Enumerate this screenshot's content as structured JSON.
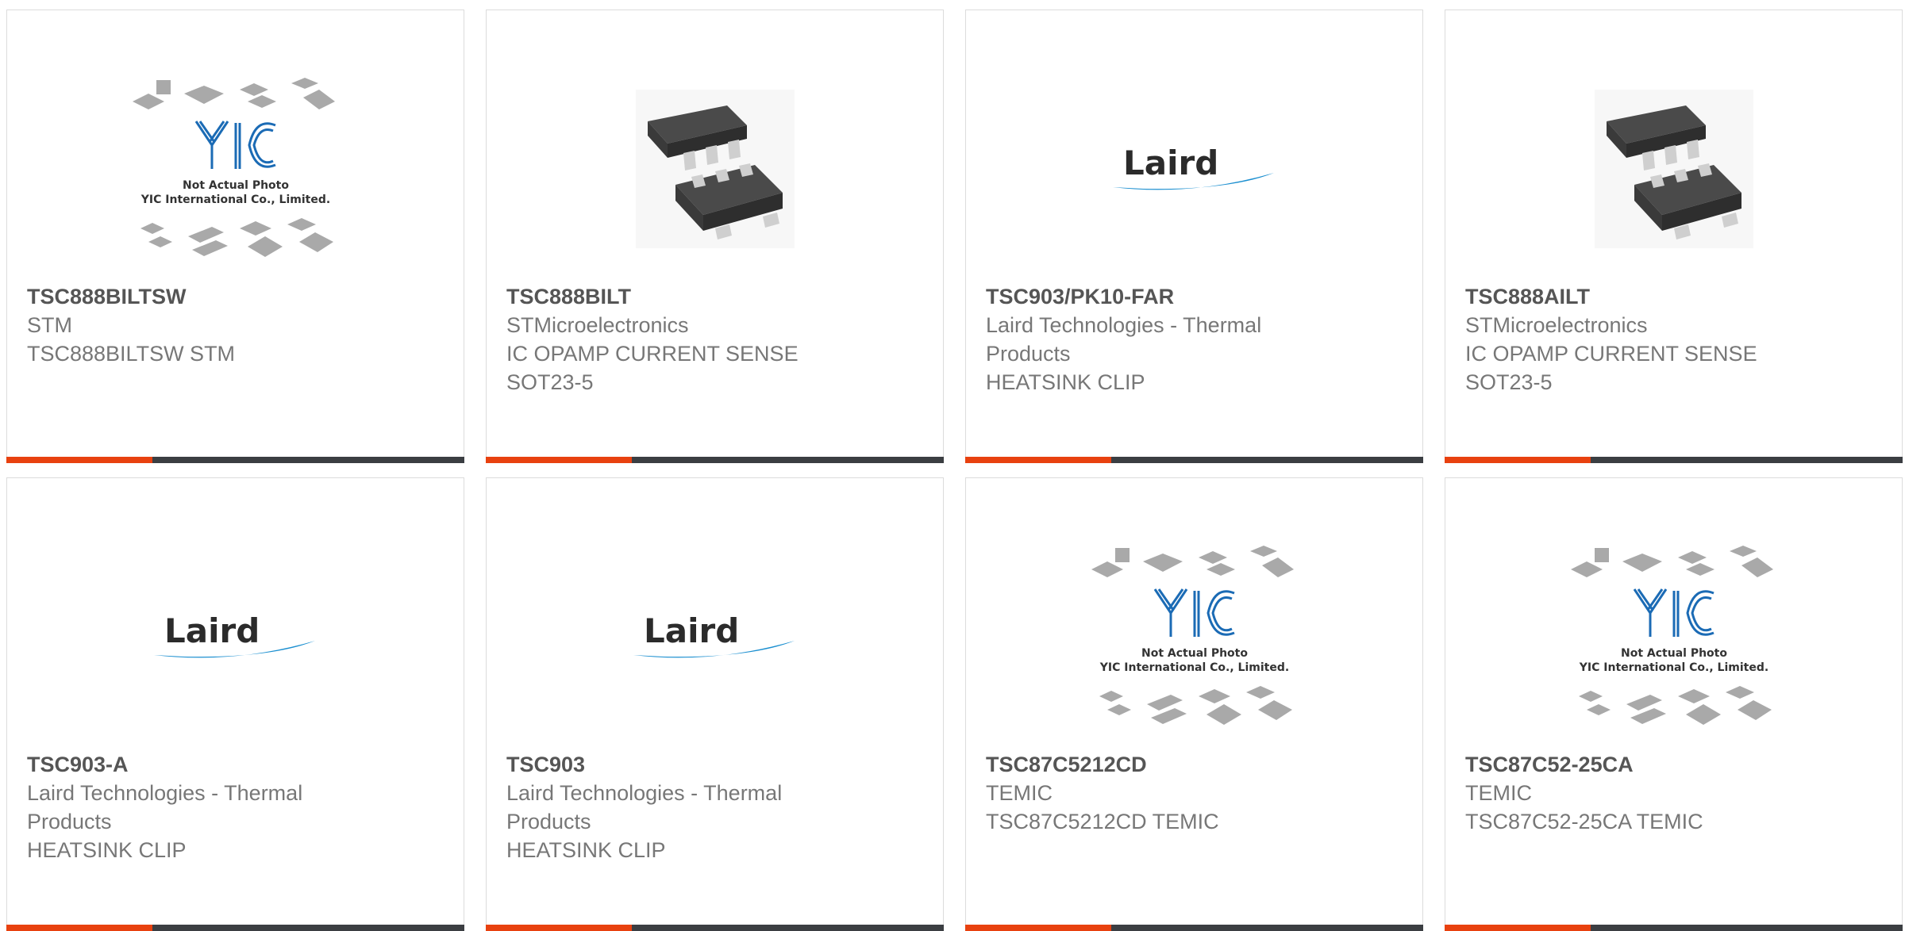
{
  "colors": {
    "accent": "#e8410f",
    "bar": "#3b3e42",
    "laird_blue": "#1b8fd0",
    "yic_blue": "#1b6bb5"
  },
  "products": [
    {
      "part_number": "TSC888BILTSW",
      "lines": [
        "STM",
        "TSC888BILTSW STM"
      ],
      "image": "yic-placeholder",
      "placeholder_text": [
        "Not Actual Photo",
        "YIC International Co., Limited."
      ],
      "logo_text": ""
    },
    {
      "part_number": "TSC888BILT",
      "lines": [
        "STMicroelectronics",
        "IC OPAMP CURRENT SENSE",
        "SOT23-5"
      ],
      "image": "chip-photo",
      "placeholder_text": [],
      "logo_text": ""
    },
    {
      "part_number": "TSC903/PK10-FAR",
      "lines": [
        "Laird Technologies - Thermal",
        "Products",
        "HEATSINK CLIP"
      ],
      "image": "laird-logo",
      "placeholder_text": [],
      "logo_text": "Laird"
    },
    {
      "part_number": "TSC888AILT",
      "lines": [
        "STMicroelectronics",
        "IC OPAMP CURRENT SENSE",
        "SOT23-5"
      ],
      "image": "chip-photo",
      "placeholder_text": [],
      "logo_text": ""
    },
    {
      "part_number": "TSC903-A",
      "lines": [
        "Laird Technologies - Thermal",
        "Products",
        "HEATSINK CLIP"
      ],
      "image": "laird-logo",
      "placeholder_text": [],
      "logo_text": "Laird"
    },
    {
      "part_number": "TSC903",
      "lines": [
        "Laird Technologies - Thermal",
        "Products",
        "HEATSINK CLIP"
      ],
      "image": "laird-logo",
      "placeholder_text": [],
      "logo_text": "Laird"
    },
    {
      "part_number": "TSC87C5212CD",
      "lines": [
        "TEMIC",
        "TSC87C5212CD TEMIC"
      ],
      "image": "yic-placeholder",
      "placeholder_text": [
        "Not Actual Photo",
        "YIC International Co., Limited."
      ],
      "logo_text": ""
    },
    {
      "part_number": "TSC87C52-25CA",
      "lines": [
        "TEMIC",
        "TSC87C52-25CA TEMIC"
      ],
      "image": "yic-placeholder",
      "placeholder_text": [
        "Not Actual Photo",
        "YIC International Co., Limited."
      ],
      "logo_text": ""
    }
  ]
}
